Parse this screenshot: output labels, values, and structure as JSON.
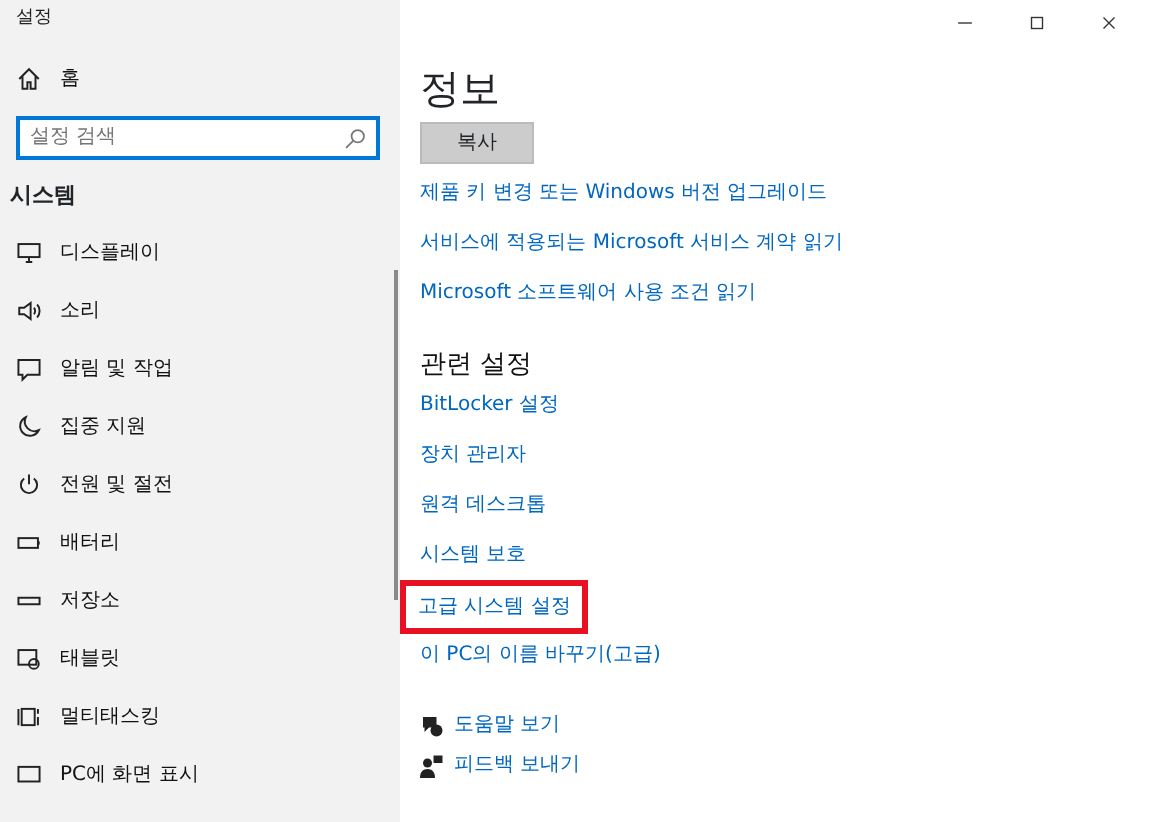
{
  "window": {
    "title": "설정"
  },
  "sidebar": {
    "home": "홈",
    "search": {
      "placeholder": "설정 검색"
    },
    "section": "시스템",
    "items": [
      {
        "kind": "display",
        "label": "디스플레이"
      },
      {
        "kind": "sound",
        "label": "소리"
      },
      {
        "kind": "notify",
        "label": "알림 및 작업"
      },
      {
        "kind": "focus",
        "label": "집중 지원"
      },
      {
        "kind": "power",
        "label": "전원 및 절전"
      },
      {
        "kind": "battery",
        "label": "배터리"
      },
      {
        "kind": "storage",
        "label": "저장소"
      },
      {
        "kind": "tablet",
        "label": "태블릿"
      },
      {
        "kind": "multitask",
        "label": "멀티태스킹"
      },
      {
        "kind": "project",
        "label": "PC에 화면 표시"
      }
    ]
  },
  "main": {
    "title": "정보",
    "copy_button": "복사",
    "links": [
      {
        "label": "제품 키 변경 또는 Windows 버전 업그레이드"
      },
      {
        "label": "서비스에 적용되는 Microsoft 서비스 계약 읽기"
      },
      {
        "label": "Microsoft 소프트웨어 사용 조건 읽기"
      }
    ],
    "related_title": "관련 설정",
    "related": [
      {
        "label": "BitLocker 설정",
        "highlighted": false
      },
      {
        "label": "장치 관리자",
        "highlighted": false
      },
      {
        "label": "원격 데스크톱",
        "highlighted": false
      },
      {
        "label": "시스템 보호",
        "highlighted": false
      },
      {
        "label": "고급 시스템 설정",
        "highlighted": true
      },
      {
        "label": "이 PC의 이름 바꾸기(고급)",
        "highlighted": false
      }
    ],
    "help": [
      {
        "kind": "help",
        "label": "도움말 보기"
      },
      {
        "kind": "feedback",
        "label": "피드백 보내기"
      }
    ]
  }
}
